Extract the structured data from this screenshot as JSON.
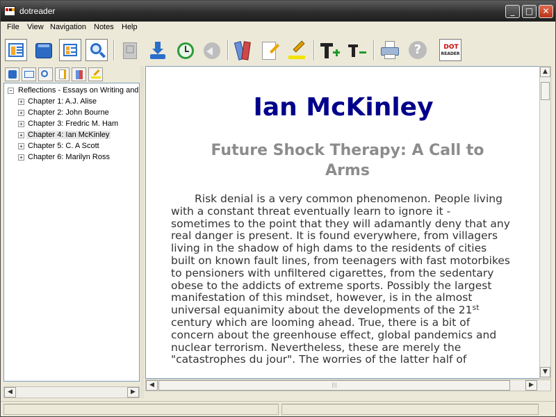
{
  "window": {
    "title": "dotreader"
  },
  "menu": [
    "File",
    "View",
    "Navigation",
    "Notes",
    "Help"
  ],
  "toolbar": {
    "icons": [
      "toc-view-icon",
      "book-library-icon",
      "tree-view-icon",
      "search-icon",
      "page-icon-disabled",
      "download-icon",
      "history-icon",
      "back-icon-disabled",
      "bookmarks-icon",
      "notes-edit-icon",
      "highlight-icon",
      "font-increase-icon",
      "font-decrease-icon",
      "print-icon",
      "help-icon",
      "dotreader-logo-icon"
    ],
    "logo_text": [
      "DOT",
      "READER"
    ]
  },
  "left_tabs": [
    "library-tab-icon",
    "toc-tab-icon",
    "search-tab-icon",
    "notes-tab-icon",
    "bookmarks-tab-icon",
    "highlights-tab-icon"
  ],
  "tree": {
    "root": "Reflections - Essays on Writing and",
    "expander_collapsed": "+",
    "expander_expanded": "−",
    "chapters": [
      "Chapter 1: A.J. Alise",
      "Chapter 2: John Bourne",
      "Chapter 3: Fredric M. Ham",
      "Chapter 4: Ian McKinley",
      "Chapter 5: C. A Scott",
      "Chapter 6: Marilyn Ross"
    ],
    "selected_index": 3
  },
  "content": {
    "author": "Ian McKinley",
    "essay_title": "Future Shock Therapy: A Call to Arms",
    "paragraph_before_sup": "Risk denial is a very common phenomenon. People living with a constant threat eventually learn to ignore it - sometimes to the point that they will adamantly deny that any real danger is present. It is found everywhere, from villagers living in the shadow of high dams to the residents of cities built on known fault lines, from teenagers with fast motorbikes to pensioners with unfiltered cigarettes, from the sedentary obese to the addicts of extreme sports. Possibly the largest manifestation of this mindset, however, is in the almost universal equanimity about the developments of the 21",
    "sup": "st",
    "paragraph_after_sup": " century which are looming ahead. True, there is a bit of concern about the greenhouse effect, global pandemics and nuclear terrorism. Nevertheless, these are merely the \"catastrophes du jour\". The worries of the latter half of"
  },
  "scroll": {
    "up": "▲",
    "down": "▼",
    "left": "◀",
    "right": "▶",
    "grip": "|||"
  },
  "window_buttons": {
    "minimize": "_",
    "maximize": "□",
    "close": "✕"
  }
}
